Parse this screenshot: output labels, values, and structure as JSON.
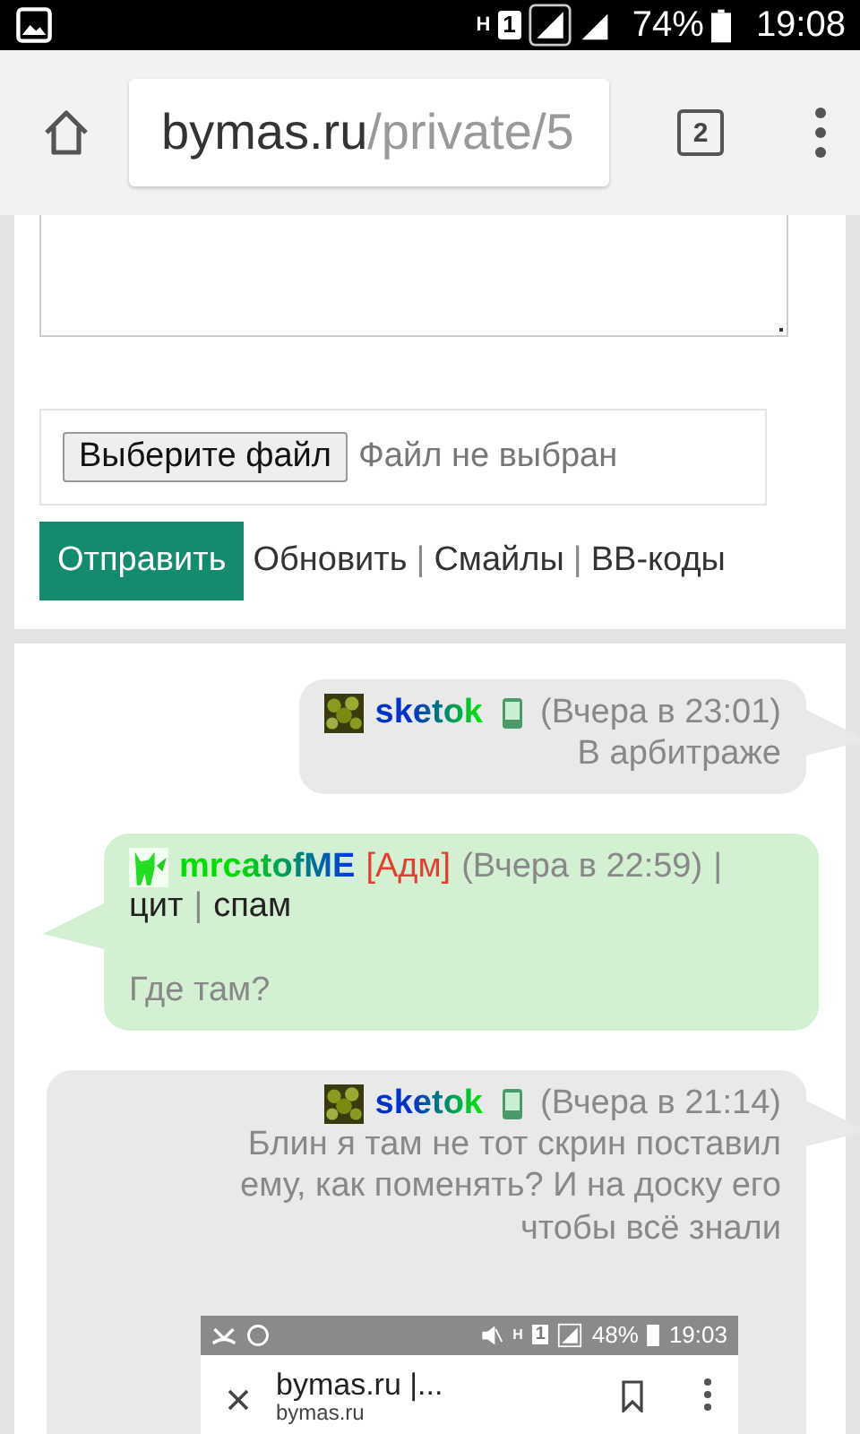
{
  "status_bar": {
    "network": "H",
    "sim": "1",
    "battery": "74%",
    "time": "19:08"
  },
  "browser": {
    "url_host": "bymas.ru",
    "url_path": "/private/5",
    "tab_count": "2"
  },
  "form": {
    "file_button": "Выберите файл",
    "file_status": "Файл не выбран",
    "submit": "Отправить",
    "links": [
      {
        "kind": "link",
        "text": "Обновить"
      },
      {
        "kind": "separator",
        "text": "|"
      },
      {
        "kind": "link",
        "text": "Смайлы"
      },
      {
        "kind": "separator",
        "text": "|"
      },
      {
        "kind": "link",
        "text": "BB-коды"
      }
    ]
  },
  "messages": [
    {
      "kind": "incoming",
      "author": "sketok",
      "avatar": {
        "kind": "bush"
      },
      "mobile": true,
      "time": "(Вчера в 23:01)",
      "body": "В арбитраже"
    },
    {
      "kind": "outgoing",
      "author": "mrcatofME",
      "avatar": {
        "kind": "cat"
      },
      "mobile": false,
      "badge": "[Адм]",
      "time": "(Вчера в 22:59)",
      "actions": [
        {
          "kind": "separator",
          "text": "|"
        },
        {
          "kind": "link",
          "text": "цит"
        },
        {
          "kind": "separator",
          "text": "|"
        },
        {
          "kind": "link",
          "text": "спам"
        }
      ],
      "body": "Где там?"
    },
    {
      "kind": "incoming",
      "author": "sketok",
      "avatar": {
        "kind": "bush"
      },
      "mobile": true,
      "time": "(Вчера в 21:14)",
      "body": "Блин я там не тот скрин поставил ему, как поменять? И на доску его чтобы всё знали",
      "attachment": {
        "network": "H",
        "sim": "1",
        "battery": "48%",
        "time": "19:03",
        "page_title": "bymas.ru |...",
        "page_host": "bymas.ru"
      }
    }
  ]
}
